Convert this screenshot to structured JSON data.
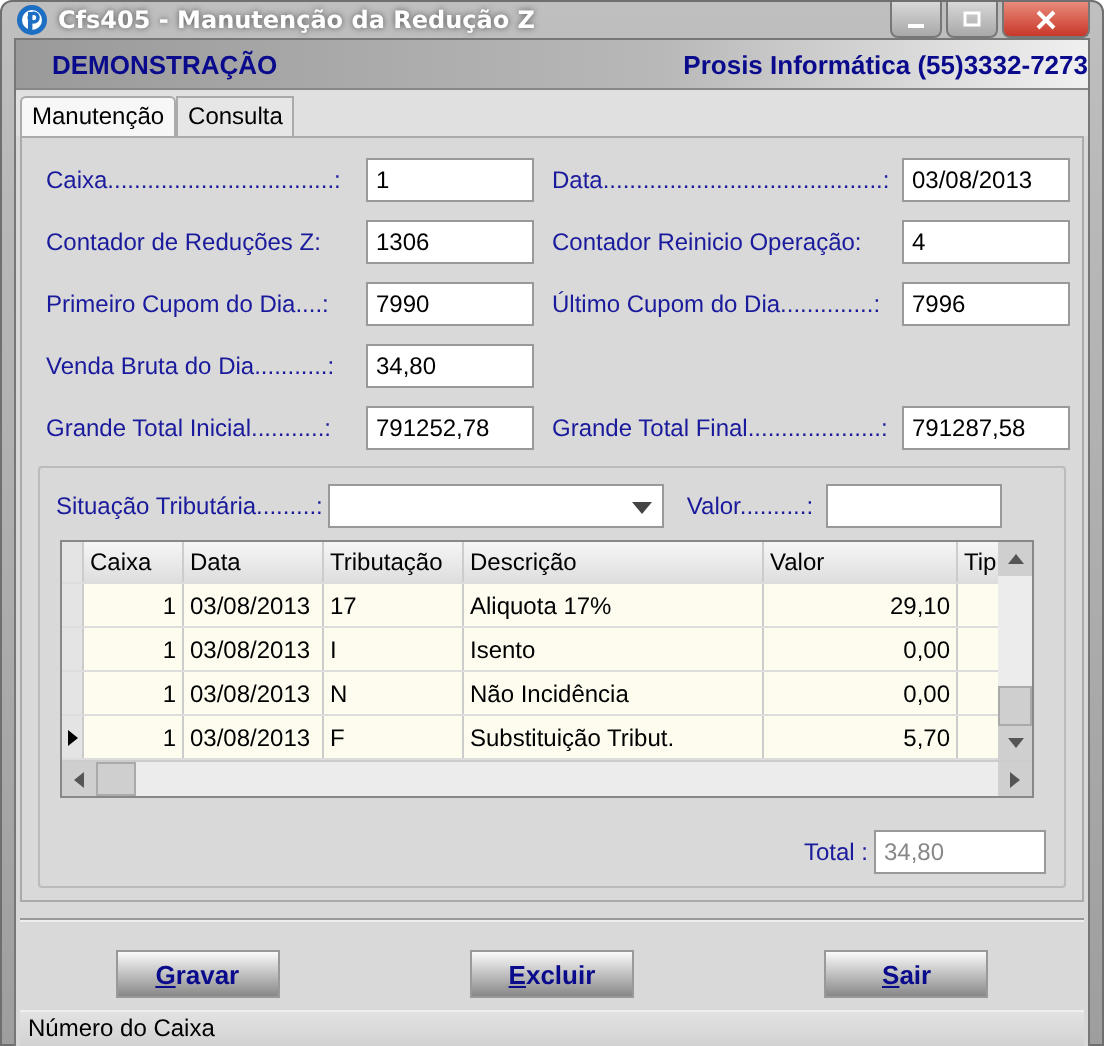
{
  "window": {
    "title": "Cfs405 - Manutenção da Redução Z"
  },
  "header": {
    "company": "DEMONSTRAÇÃO",
    "vendor": "Prosis Informática (55)3332-7273"
  },
  "tabs": [
    {
      "label": "Manutenção",
      "selected": true
    },
    {
      "label": "Consulta",
      "selected": false
    }
  ],
  "field_rows": [
    [
      {
        "label": "Caixa..................................:",
        "value": "1"
      },
      {
        "label": "Data..........................................:",
        "value": "03/08/2013"
      }
    ],
    [
      {
        "label": "Contador de Reduções Z:",
        "value": "1306"
      },
      {
        "label": "Contador Reinicio Operação:",
        "value": "4"
      }
    ],
    [
      {
        "label": "Primeiro Cupom do Dia....:",
        "value": "7990"
      },
      {
        "label": "Último Cupom do Dia..............:",
        "value": "7996"
      }
    ],
    [
      {
        "label": "Venda Bruta do Dia...........:",
        "value": "34,80"
      }
    ],
    [
      {
        "label": "Grande Total Inicial...........:",
        "value": "791252,78"
      },
      {
        "label": "Grande Total Final....................:",
        "value": "791287,58"
      }
    ]
  ],
  "filter": {
    "situacao_label": "Situação Tributária.........:",
    "valor_label": "Valor..........:"
  },
  "table": {
    "columns": [
      "Caixa",
      "Data",
      "Tributação",
      "Descrição",
      "Valor",
      "Tip"
    ],
    "rows": [
      {
        "cells": [
          "1",
          "03/08/2013",
          "17",
          "Aliquota 17%",
          "29,10",
          ""
        ],
        "current": false
      },
      {
        "cells": [
          "1",
          "03/08/2013",
          "I",
          "Isento",
          "0,00",
          ""
        ],
        "current": false
      },
      {
        "cells": [
          "1",
          "03/08/2013",
          "N",
          "Não Incidência",
          "0,00",
          ""
        ],
        "current": false
      },
      {
        "cells": [
          "1",
          "03/08/2013",
          "F",
          "Substituição Tribut.",
          "5,70",
          ""
        ],
        "current": true
      }
    ]
  },
  "total": {
    "label": "Total :",
    "value": "34,80",
    "disabled": true
  },
  "buttons": [
    "Gravar",
    "Excluir",
    "Sair"
  ],
  "status_bar": "Número do Caixa"
}
